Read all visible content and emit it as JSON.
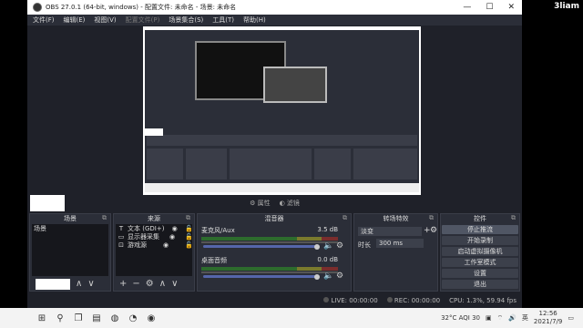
{
  "window": {
    "title": "OBS 27.0.1 (64-bit, windows) - 配置文件: 未命名 - 场景: 未命名",
    "ctrl_min": "—",
    "ctrl_max": "☐",
    "ctrl_close": "✕"
  },
  "menu": {
    "file": "文件(F)",
    "edit": "编辑(E)",
    "view": "视图(V)",
    "profile": "配置文件(P)",
    "scenes": "场景集合(S)",
    "tools": "工具(T)",
    "help": "帮助(H)"
  },
  "overlay_text": "3liam",
  "lbar": {
    "properties": "属性",
    "filters": "滤镜"
  },
  "scenes": {
    "title": "场景",
    "items": [
      "场景"
    ]
  },
  "sources": {
    "title": "来源",
    "items": [
      {
        "icon": "T",
        "label": "文本 (GDI+)"
      },
      {
        "icon": "▭",
        "label": "显示器采集"
      },
      {
        "icon": "⊡",
        "label": "游戏源"
      }
    ]
  },
  "mixer": {
    "title": "混音器",
    "tracks": [
      {
        "name": "麦克风/Aux",
        "db": "3.5 dB",
        "level": 0.85
      },
      {
        "name": "桌面音频",
        "db": "0.0 dB",
        "level": 0.82
      }
    ]
  },
  "transitions": {
    "title": "转场特效",
    "type": "淡变",
    "duration_label": "时长",
    "duration": "300 ms"
  },
  "controls": {
    "title": "控件",
    "buttons": [
      "停止推流",
      "开始录制",
      "启动虚拟摄像机",
      "工作室模式",
      "设置",
      "退出"
    ]
  },
  "status": {
    "live": "LIVE: 00:00:00",
    "rec": "REC: 00:00:00",
    "cpu": "CPU: 1.3%, 59.94 fps"
  },
  "taskbar": {
    "weather": "32°C AQI 30",
    "lang": "英",
    "time": "12:56",
    "date": "2021/7/9"
  }
}
